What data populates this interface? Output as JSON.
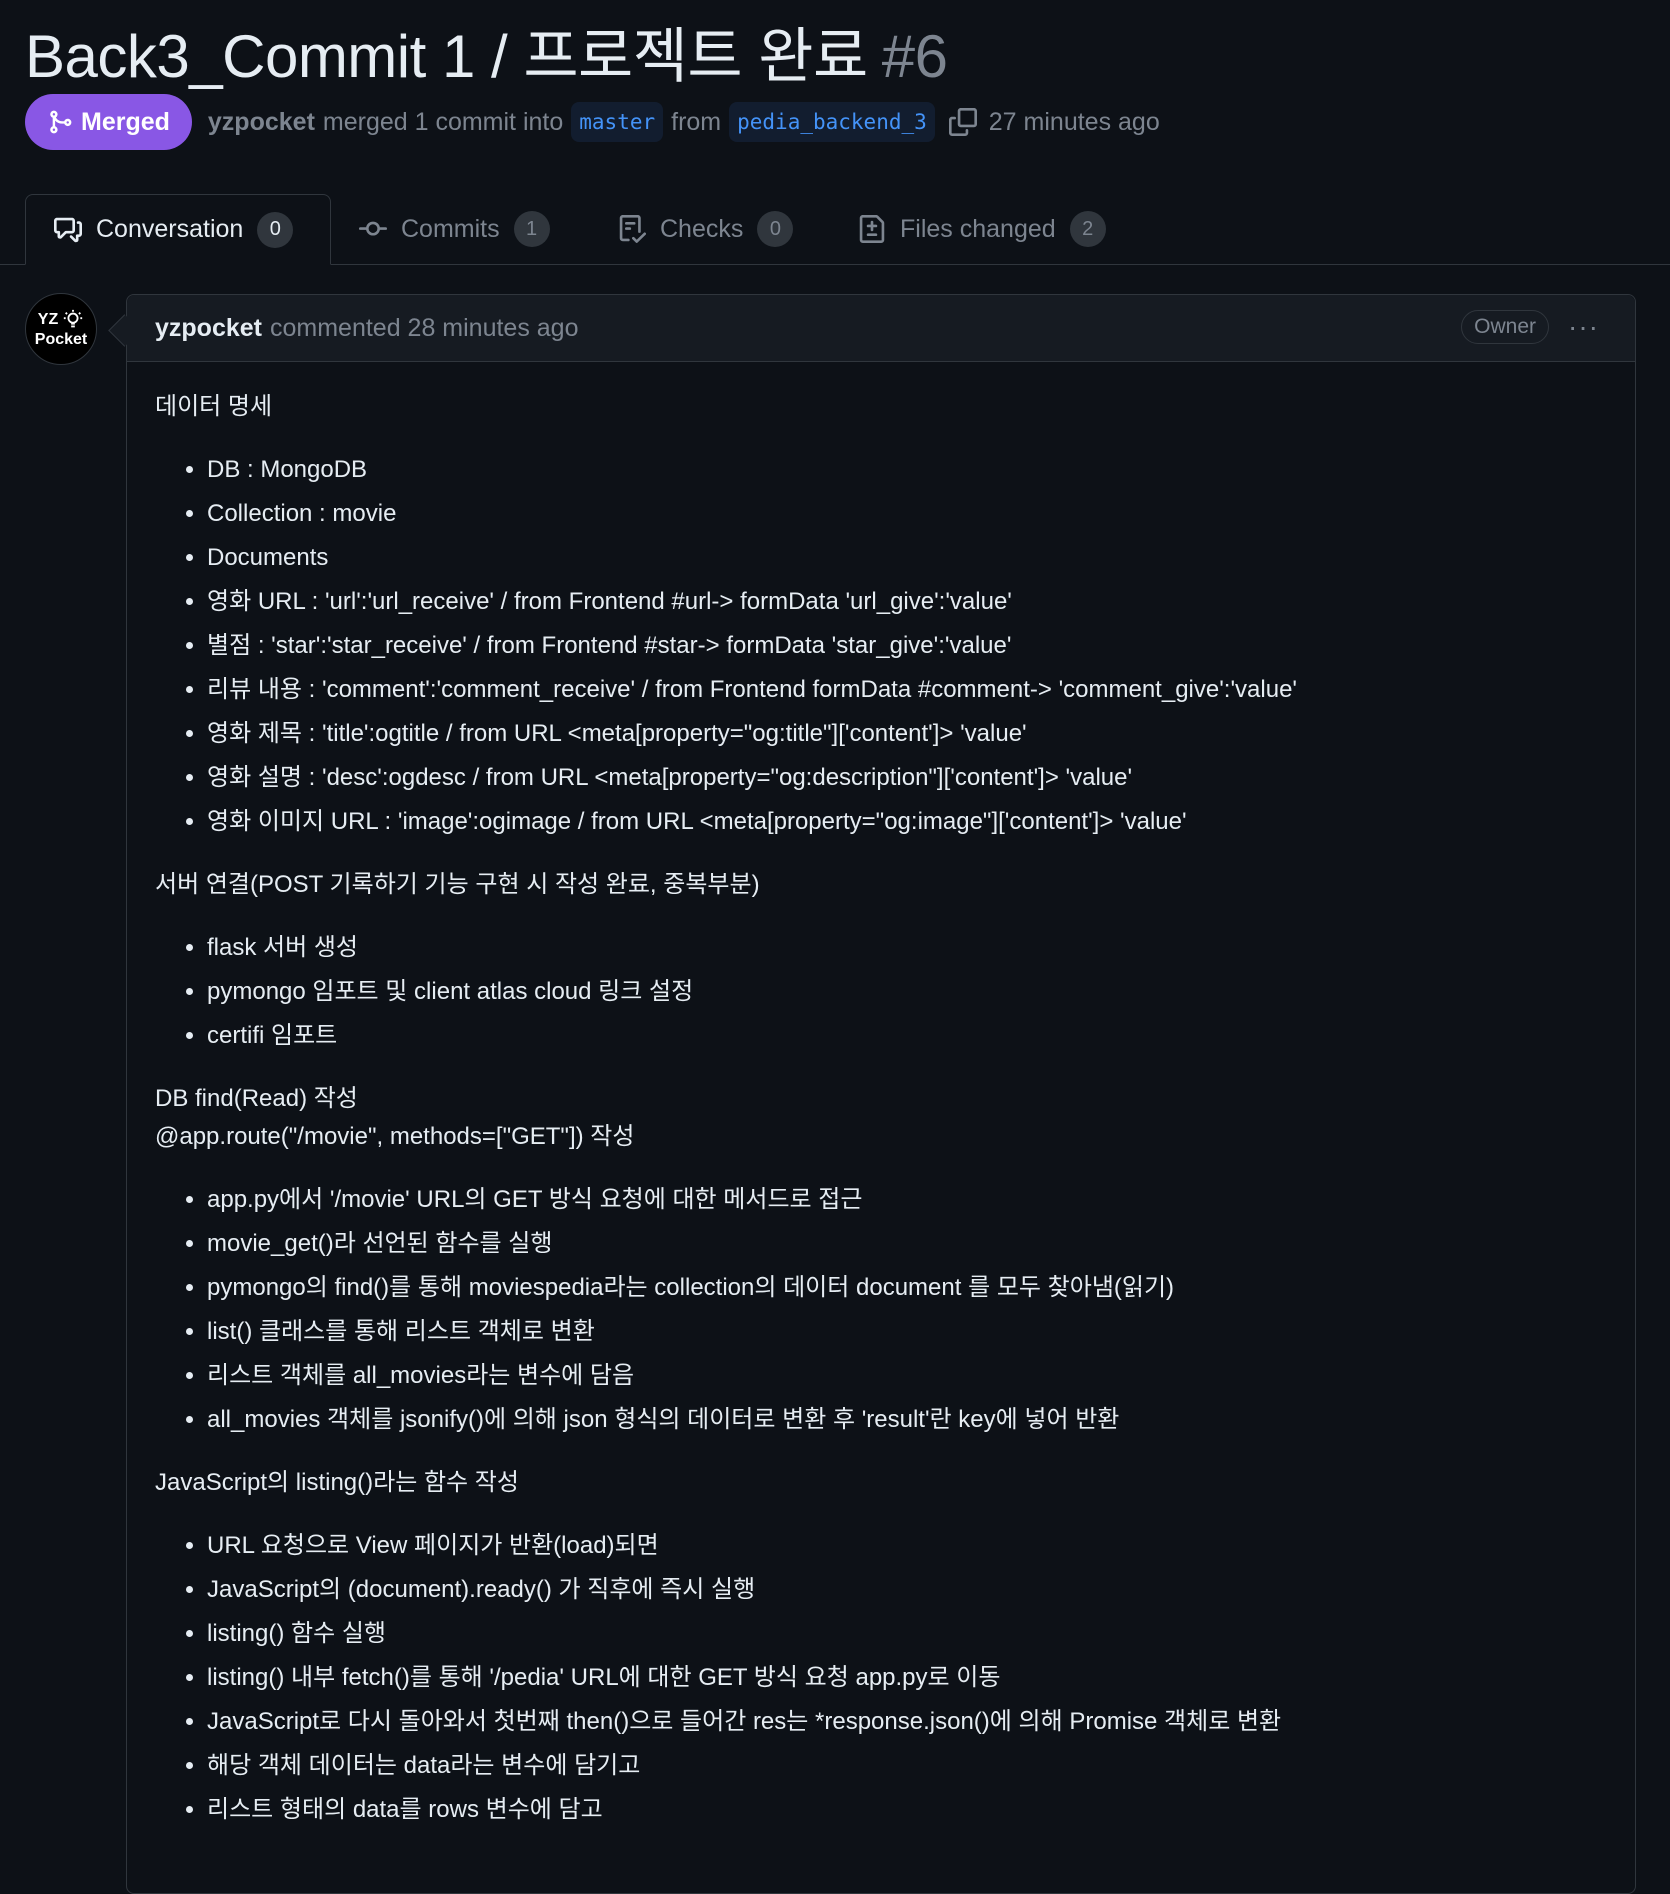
{
  "pr": {
    "title": "Back3_Commit 1 / 프로젝트 완료",
    "number": "#6",
    "status": "Merged",
    "user": "yzpocket",
    "action_text": "merged 1 commit into",
    "base_branch": "master",
    "from_text": "from",
    "head_branch": "pedia_backend_3",
    "time": "27 minutes ago"
  },
  "tabs": [
    {
      "label": "Conversation",
      "count": "0",
      "icon": "conversation-icon"
    },
    {
      "label": "Commits",
      "count": "1",
      "icon": "commit-icon"
    },
    {
      "label": "Checks",
      "count": "0",
      "icon": "checks-icon"
    },
    {
      "label": "Files changed",
      "count": "2",
      "icon": "file-diff-icon"
    }
  ],
  "avatar": {
    "line1": "YZ",
    "line2": "Pocket"
  },
  "comment": {
    "author": "yzpocket",
    "meta": "commented 28 minutes ago",
    "badge": "Owner",
    "more": "···",
    "sections": [
      {
        "heading": "데이터 명세",
        "items": [
          "DB : MongoDB",
          "Collection : movie",
          "Documents",
          "영화 URL : 'url':'url_receive' / from Frontend #url-> formData 'url_give':'value'",
          "별점 : 'star':'star_receive' / from Frontend #star-> formData 'star_give':'value'",
          "리뷰 내용 : 'comment':'comment_receive' / from Frontend formData #comment-> 'comment_give':'value'",
          "영화 제목 : 'title':ogtitle / from URL <meta[property=\"og:title\"]['content']> 'value'",
          "영화 설명 : 'desc':ogdesc / from URL <meta[property=\"og:description\"]['content']> 'value'",
          "영화 이미지 URL : 'image':ogimage / from URL <meta[property=\"og:image\"]['content']> 'value'"
        ]
      },
      {
        "heading": "서버 연결(POST 기록하기 기능 구현 시 작성 완료, 중복부분)",
        "items": [
          "flask 서버 생성",
          "pymongo 임포트 및 client atlas cloud 링크 설정",
          "certifi 임포트"
        ]
      },
      {
        "heading": "DB find(Read) 작성",
        "heading2": "@app.route(\"/movie\", methods=[\"GET\"]) 작성",
        "items": [
          "app.py에서 '/movie' URL의 GET 방식 요청에 대한 메서드로 접근",
          "movie_get()라 선언된 함수를 실행",
          "pymongo의 find()를 통해 moviespedia라는 collection의 데이터 document 를 모두 찾아냄(읽기)",
          "list() 클래스를 통해 리스트 객체로 변환",
          "리스트 객체를 all_movies라는 변수에 담음",
          "all_movies 객체를 jsonify()에 의해 json 형식의 데이터로 변환 후 'result'란 key에 넣어 반환"
        ]
      },
      {
        "heading": "JavaScript의 listing()라는 함수 작성",
        "items": [
          "URL 요청으로 View 페이지가 반환(load)되면",
          "JavaScript의 (document).ready() 가 직후에 즉시 실행",
          "listing() 함수 실행",
          "listing() 내부 fetch()를 통해 '/pedia' URL에 대한 GET 방식 요청 app.py로 이동",
          "JavaScript로 다시 돌아와서 첫번째 then()으로 들어간 res는 *response.json()에 의해 Promise 객체로 변환",
          "해당 객체 데이터는 data라는 변수에 담기고",
          "리스트 형태의 data를 rows 변수에 담고"
        ]
      }
    ]
  }
}
